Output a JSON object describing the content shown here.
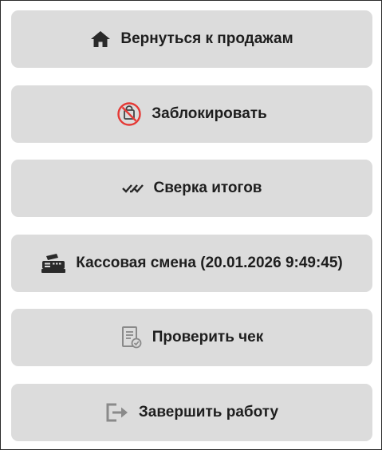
{
  "menu": {
    "items": [
      {
        "icon": "home-icon",
        "label": "Вернуться к продажам"
      },
      {
        "icon": "lock-blocked-icon",
        "label": "Заблокировать",
        "accent": "#e53935"
      },
      {
        "icon": "double-check-icon",
        "label": "Сверка итогов"
      },
      {
        "icon": "cash-register-icon",
        "label": "Кассовая смена (20.01.2026 9:49:45)"
      },
      {
        "icon": "receipt-check-icon",
        "label": "Проверить чек"
      },
      {
        "icon": "logout-icon",
        "label": "Завершить работу"
      }
    ]
  },
  "colors": {
    "button_bg": "#dcdcdc",
    "text": "#1e1e1e",
    "icon_dark": "#2a2a2a",
    "icon_gray": "#8a8a8a"
  }
}
